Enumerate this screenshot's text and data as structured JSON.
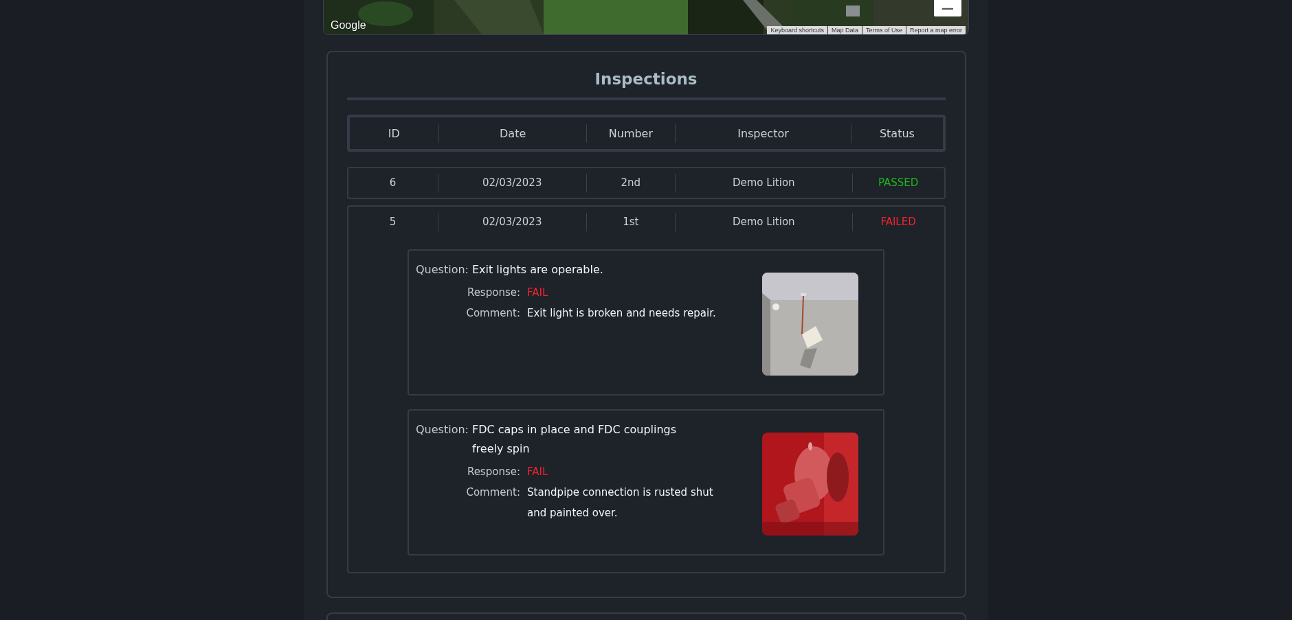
{
  "map": {
    "kind": "picture",
    "logo": "Google",
    "zoom_out": "−",
    "attribution": [
      "Keyboard shortcuts",
      "Map Data",
      "Terms of Use",
      "Report a map error"
    ]
  },
  "inspections": {
    "title": "Inspections",
    "columns": [
      "ID",
      "Date",
      "Number",
      "Inspector",
      "Status"
    ],
    "rows": [
      {
        "id": "6",
        "date": "02/03/2023",
        "number": "2nd",
        "inspector": "Demo Lition",
        "status": "PASSED",
        "color": "#1fb51f",
        "expanded": false,
        "questions": []
      },
      {
        "id": "5",
        "date": "02/03/2023",
        "number": "1st",
        "inspector": "Demo Lition",
        "status": "FAILED",
        "color": "#f0242d",
        "expanded": true,
        "questions": [
          {
            "question_label": "Question:",
            "question": "Exit lights are operable.",
            "response_label": "Response:",
            "response": "FAIL",
            "color": "#f0242d",
            "comment_label": "Comment:",
            "comment": "Exit light is broken and needs repair."
          },
          {
            "question_label": "Question:",
            "question": "FDC caps in place and FDC couplings freely spin",
            "response_label": "Response:",
            "response": "FAIL",
            "color": "#f0242d",
            "comment_label": "Comment:",
            "comment": "Standpipe connection is rusted shut and painted over."
          }
        ]
      }
    ]
  }
}
